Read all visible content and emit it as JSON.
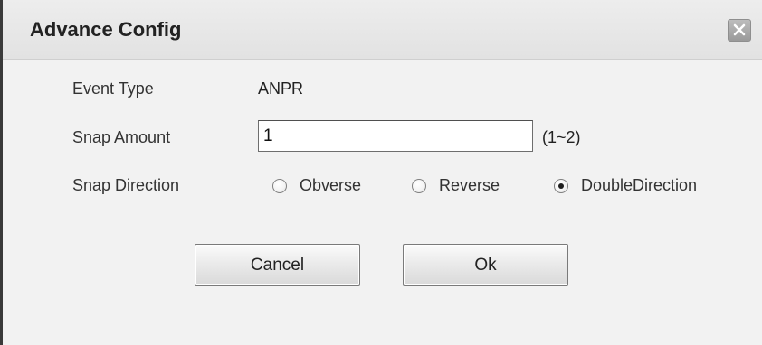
{
  "dialog": {
    "title": "Advance Config",
    "close_icon": "close-icon"
  },
  "form": {
    "event_type": {
      "label": "Event Type",
      "value": "ANPR"
    },
    "snap_amount": {
      "label": "Snap Amount",
      "value": "1",
      "range_hint": "(1~2)"
    },
    "snap_direction": {
      "label": "Snap Direction",
      "options": [
        {
          "label": "Obverse",
          "checked": false
        },
        {
          "label": "Reverse",
          "checked": false
        },
        {
          "label": "DoubleDirection",
          "checked": true
        }
      ]
    }
  },
  "buttons": {
    "cancel_label": "Cancel",
    "ok_label": "Ok"
  }
}
